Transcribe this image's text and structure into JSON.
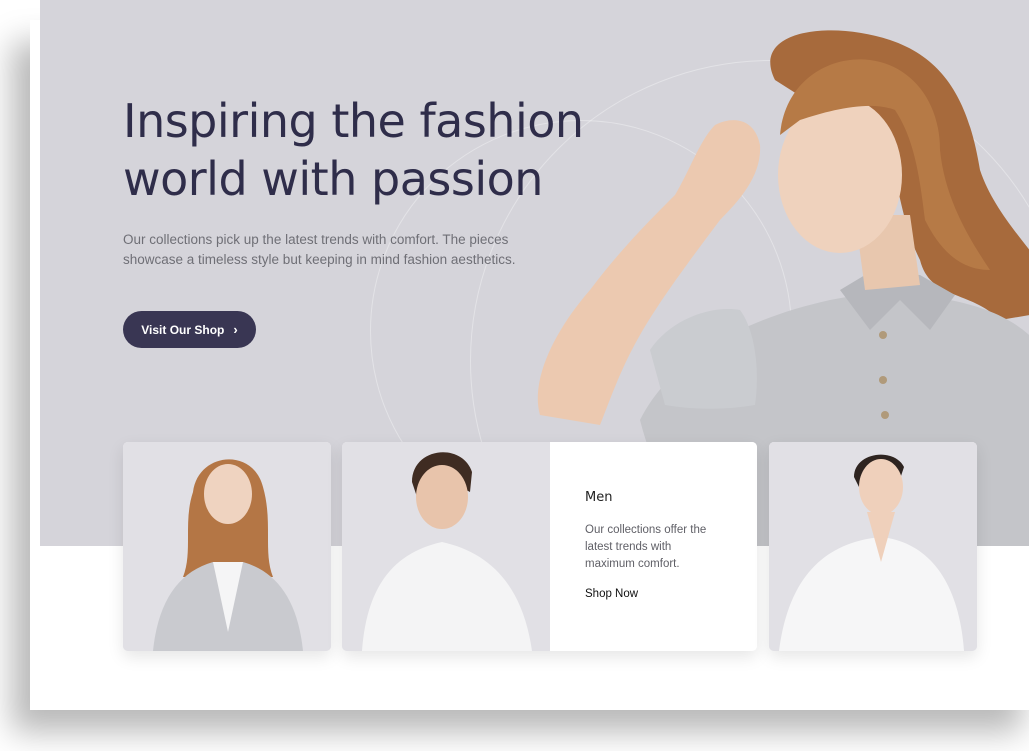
{
  "hero": {
    "headline_line1": "Inspiring the fashion",
    "headline_line2": "world with passion",
    "subtext_line1": "Our collections pick up the latest trends with comfort. The pieces",
    "subtext_line2": "showcase a timeless style but keeping in mind fashion aesthetics.",
    "cta_label": "Visit Our Shop",
    "cta_icon": "chevron-right-icon"
  },
  "cards": {
    "featured": {
      "title": "Men",
      "desc_line1": "Our collections offer the",
      "desc_line2": "latest trends with",
      "desc_line3": "maximum comfort.",
      "link": "Shop Now"
    }
  },
  "colors": {
    "hero_bg": "#d5d4da",
    "headline": "#2f2d4a",
    "button_bg": "#393653",
    "card_photo_bg": "#e1e0e5"
  }
}
